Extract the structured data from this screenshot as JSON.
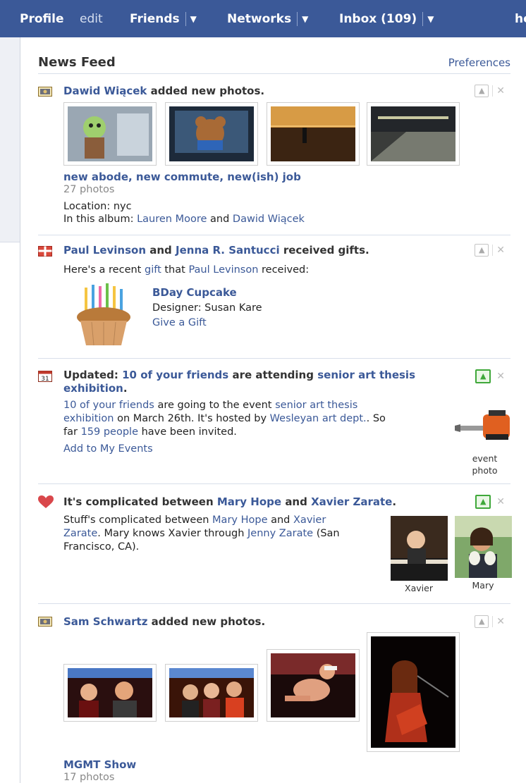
{
  "topnav": {
    "profile": "Profile",
    "edit": "edit",
    "friends": "Friends",
    "networks": "Networks",
    "inbox": "Inbox (109)",
    "caret": "▼",
    "overflow": "he"
  },
  "feed": {
    "title": "News Feed",
    "preferences": "Preferences"
  },
  "story1": {
    "actor": "Dawid Wiącek",
    "action": "added new photos.",
    "album_title": "new abode, new commute, new(ish) job",
    "photo_count": "27 photos",
    "location": "Location: nyc",
    "in_album_label": "In this album:",
    "person1": "Lauren Moore",
    "and": "and",
    "person2": "Dawid Wiącek"
  },
  "story2": {
    "actor1": "Paul Levinson",
    "and": "and",
    "actor2": "Jenna R. Santucci",
    "action": "received gifts.",
    "desc_prefix": "Here's a recent",
    "gift_link": "gift",
    "desc_mid": "that",
    "desc_person": "Paul Levinson",
    "desc_suffix": "received:",
    "gift_name": "BDay Cupcake",
    "designer": "Designer: Susan Kare",
    "give": "Give a Gift"
  },
  "story3": {
    "prefix": "Updated:",
    "friends_link": "10 of your friends",
    "mid": "are attending",
    "event_line1": "senior art thesis",
    "event_line2": "exhibition",
    "period": ".",
    "body_friends": "10 of your friends",
    "body_going": "are going to the event",
    "body_event_a": "senior art thesis",
    "body_event_b": "exhibition",
    "body_date": "on March 26th. It's hosted by",
    "body_host": "Wesleyan art dept.",
    "body_so": ". So",
    "body_far": "far",
    "body_people": "159 people",
    "body_invited": "have been invited.",
    "add": "Add to My Events",
    "photo_cap1": "event",
    "photo_cap2": "photo",
    "calendar_day": "31"
  },
  "story4": {
    "prefix": "It's complicated between",
    "person1": "Mary Hope",
    "and": "and",
    "person2": "Xavier Zarate",
    "period": ".",
    "body_a": "Stuff's complicated between",
    "body_p1": "Mary Hope",
    "body_and": "and",
    "body_x1": "Xavier",
    "body_x2": "Zarate",
    "body_b": ". Mary knows Xavier through",
    "body_jenny": "Jenny Zarate",
    "body_c": "(San",
    "body_d": "Francisco, CA).",
    "cap_xavier": "Xavier",
    "cap_mary": "Mary"
  },
  "story5": {
    "actor": "Sam Schwartz",
    "action": "added new photos.",
    "album_title": "MGMT Show",
    "photo_count": "17 photos"
  },
  "colors": {
    "topbar": "#3b5998",
    "link": "#3b5998",
    "like_active": "#3fa83a"
  },
  "icons": [
    "photo-icon",
    "gift-icon",
    "calendar-icon",
    "heart-icon",
    "thumbs-up-icon",
    "close-icon",
    "dropdown-caret-icon"
  ]
}
